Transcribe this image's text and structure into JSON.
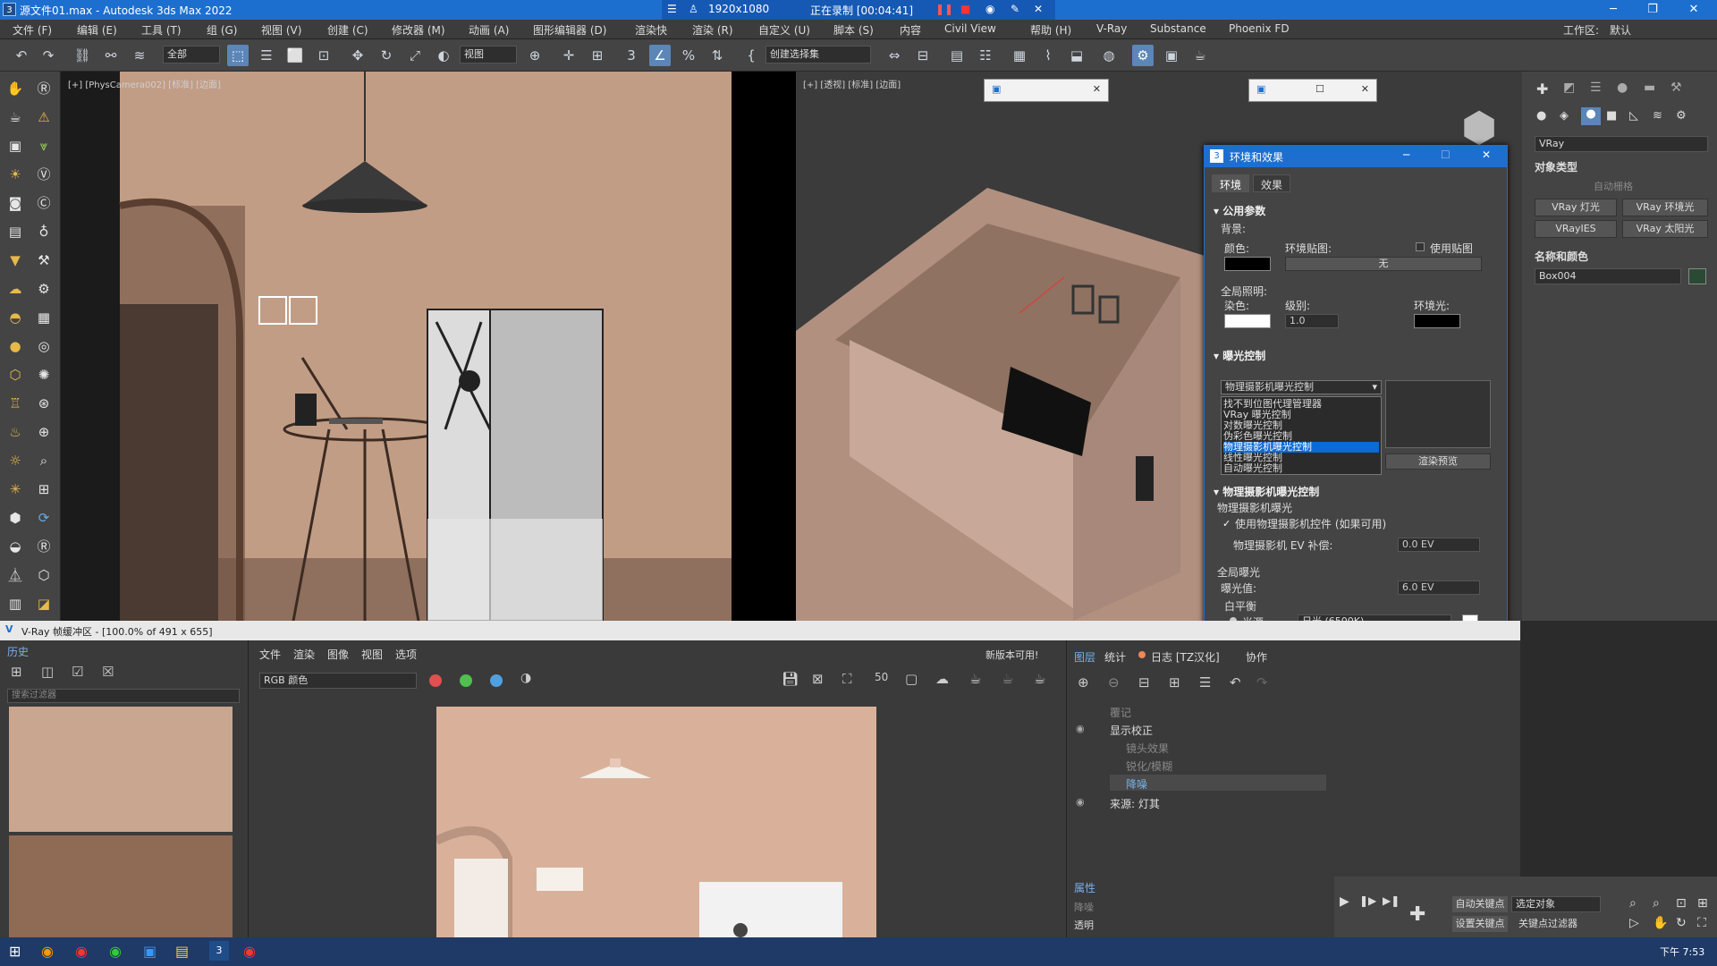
{
  "titlebar": {
    "app_title": "源文件01.max - Autodesk 3ds Max 2022",
    "resolution": "1920x1080",
    "recording": "正在录制 [00:04:41]"
  },
  "menu": [
    "文件 (F)",
    "编辑 (E)",
    "工具 (T)",
    "组 (G)",
    "视图 (V)",
    "创建 (C)",
    "修改器 (M)",
    "动画 (A)",
    "图形编辑器 (D)",
    "渲染快",
    "渲染 (R)",
    "自定义 (U)",
    "脚本 (S)",
    "内容",
    "Civil View",
    "帮助 (H)",
    "V-Ray",
    "Substance",
    "Phoenix FD"
  ],
  "workspace": {
    "label": "工作区:",
    "value": "默认"
  },
  "toolbar": {
    "filter": "全部",
    "view": "视图",
    "selection_set": "创建选择集"
  },
  "viewport1": {
    "label": "[+] [PhysCamera002] [标准] [边面]"
  },
  "viewport2": {
    "label": "[+] [透视] [标准] [边面]"
  },
  "env_dialog": {
    "title": "环境和效果",
    "tabs": [
      "环境",
      "效果"
    ],
    "common_params": "公用参数",
    "background": "背景:",
    "color": "颜色:",
    "env_map": "环境贴图:",
    "use_map": "使用贴图",
    "map_none": "无",
    "global_lighting": "全局照明:",
    "tint": "染色:",
    "level": "级别:",
    "level_value": "1.0",
    "ambient": "环境光:",
    "exposure_control": "曝光控制",
    "exposure_selected": "物理摄影机曝光控制",
    "exposure_options": [
      "找不到位图代理管理器",
      "VRay 曝光控制",
      "对数曝光控制",
      "伪彩色曝光控制",
      "物理摄影机曝光控制",
      "线性曝光控制",
      "自动曝光控制"
    ],
    "render_preview": "渲染预览",
    "phys_cam_section": "物理摄影机曝光控制",
    "phys_cam_exposure": "物理摄影机曝光",
    "use_phys_cam": "使用物理摄影机控件 (如果可用)",
    "ev_comp": "物理摄影机 EV 补偿:",
    "ev_comp_value": "0.0 EV",
    "global_exposure": "全局曝光",
    "exposure_value_label": "曝光值:",
    "exposure_value": "6.0 EV",
    "white_balance": "白平衡",
    "illuminant": "光源",
    "illuminant_value": "日光 (6500K)"
  },
  "cmd_panel": {
    "renderer": "VRay",
    "object_type": "对象类型",
    "auto_grid": "自动栅格",
    "buttons": [
      "VRay 灯光",
      "VRay 环境光",
      "VRayIES",
      "VRay 太阳光"
    ],
    "name_color": "名称和颜色",
    "object_name": "Box004"
  },
  "vfb": {
    "title": "V-Ray 帧缓冲区 - [100.0% of 491 x 655]",
    "history": "历史",
    "search_placeholder": "搜索过滤器",
    "menus": [
      "文件",
      "渲染",
      "图像",
      "视图",
      "选项"
    ],
    "update": "新版本可用!",
    "channel": "RGB 颜色",
    "layers_tabs": [
      "图层",
      "统计",
      "日志 [TZ汉化]",
      "协作"
    ],
    "layers": [
      "覆记",
      "显示校正",
      "镜头效果",
      "锐化/模糊",
      "降噪",
      "来源: 灯其"
    ],
    "properties": "属性",
    "prop_items": [
      "降噪",
      "透明"
    ]
  },
  "anim": {
    "auto_key": "自动关键点",
    "selected": "选定对象",
    "set_key": "设置关键点",
    "key_filter": "关键点过滤器"
  },
  "taskbar": {
    "time": "下午 7:53"
  }
}
